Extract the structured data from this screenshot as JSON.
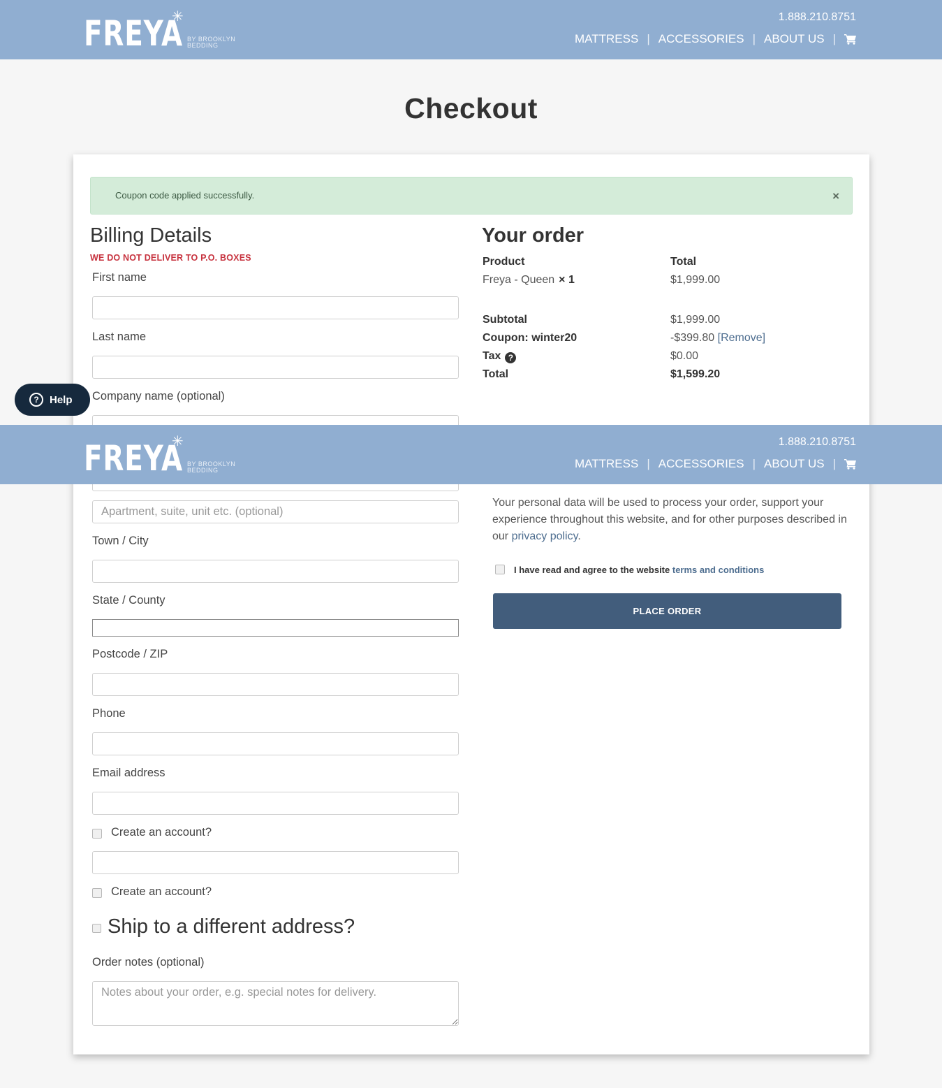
{
  "header": {
    "logo_text": "FREYA",
    "logo_subtitle_line1": "BY BROOKLYN",
    "logo_subtitle_line2": "BEDDING",
    "phone": "1.888.210.8751",
    "nav": [
      {
        "label": "MATTRESS"
      },
      {
        "label": "ACCESSORIES"
      },
      {
        "label": "ABOUT US"
      }
    ],
    "cart_icon": "shopping-cart-icon",
    "separator": "|"
  },
  "page": {
    "title": "Checkout"
  },
  "notice": {
    "message": "Coupon code applied successfully.",
    "close_glyph": "×"
  },
  "billing": {
    "heading": "Billing Details",
    "warning": "WE DO NOT DELIVER TO P.O. BOXES",
    "fields": {
      "first_name": {
        "label": "First name",
        "value": ""
      },
      "last_name": {
        "label": "Last name",
        "value": ""
      },
      "company": {
        "label": "Company name (optional)",
        "value": ""
      },
      "address_2": {
        "placeholder": "Apartment, suite, unit etc. (optional)",
        "value": ""
      },
      "city": {
        "label": "Town / City",
        "value": ""
      },
      "state": {
        "label": "State / County",
        "value": ""
      },
      "postcode": {
        "label": "Postcode / ZIP",
        "value": ""
      },
      "phone": {
        "label": "Phone",
        "value": ""
      },
      "email": {
        "label": "Email address",
        "value": ""
      },
      "extra": {
        "value": ""
      }
    },
    "create_account_1": {
      "label": "Create an account?",
      "checked": false
    },
    "create_account_2": {
      "label": "Create an account?",
      "checked": false
    },
    "ship_different": {
      "label": "Ship to a different address?",
      "checked": false
    },
    "order_notes": {
      "label": "Order notes (optional)",
      "placeholder": "Notes about your order, e.g. special notes for delivery."
    }
  },
  "order": {
    "heading": "Your order",
    "columns": [
      "Product",
      "Total"
    ],
    "items": [
      {
        "name": "Freya - Queen",
        "qty": "× 1",
        "total": "$1,999.00"
      }
    ],
    "summary": {
      "subtotal_label": "Subtotal",
      "subtotal_value": "$1,999.00",
      "coupon_label": "Coupon: winter20",
      "coupon_value": "-$399.80",
      "coupon_remove": "[Remove]",
      "tax_label": "Tax",
      "tax_value": "$0.00",
      "total_label": "Total",
      "total_value": "$1,599.20"
    },
    "privacy": {
      "text": "Your personal data will be used to process your order, support your experience throughout this website, and for other purposes described in our ",
      "link": "privacy policy",
      "end": "."
    },
    "terms": {
      "text": "I have read and agree to the website ",
      "link": "terms and conditions",
      "checked": false
    },
    "place_order": "PLACE ORDER"
  },
  "help_widget": {
    "label": "Help",
    "icon_glyph": "?"
  },
  "colors": {
    "header_bg": "#90aed1",
    "notice_bg": "#d4ecd9",
    "warning": "#c7323e",
    "button_bg": "#425d7c",
    "link": "#4d6d8f",
    "help_bg": "#16293d"
  }
}
